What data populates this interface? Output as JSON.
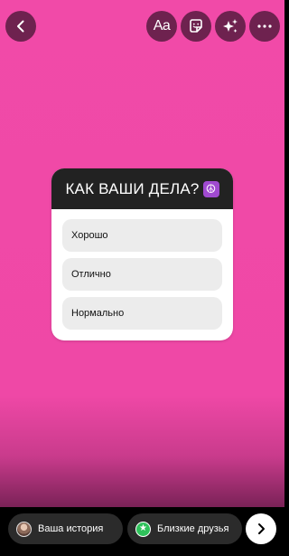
{
  "toolbar": {
    "back_icon": "chevron-left-icon",
    "text_tool_label": "Aa",
    "sticker_icon": "sticker-icon",
    "effects_icon": "sparkles-icon",
    "more_icon": "more-horizontal-icon"
  },
  "quiz": {
    "question": "КАК ВАШИ ДЕЛА?",
    "emoji": "☮",
    "options": [
      "Хорошо",
      "Отлично",
      "Нормально"
    ]
  },
  "bottom": {
    "your_story_label": "Ваша история",
    "close_friends_label": "Близкие друзья",
    "next_icon": "chevron-right-icon"
  },
  "colors": {
    "background": "#f14aa8",
    "quiz_header": "#222222",
    "option_bg": "#ececec",
    "close_friends_badge": "#2fc25b"
  }
}
